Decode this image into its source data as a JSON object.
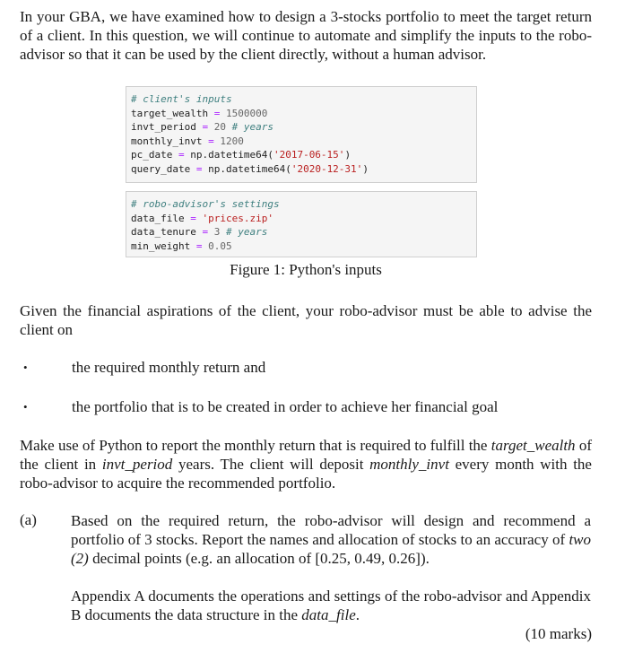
{
  "intro": {
    "text": "In your GBA, we have examined how to design a 3-stocks portfolio to meet the target return of a client. In this question, we will continue to automate and simplify the inputs to the robo-advisor so that it can be used by the client directly, without a human advisor."
  },
  "code_client": {
    "comment": "# client's inputs",
    "line1": {
      "name": "target_wealth",
      "op": "=",
      "value": "1500000"
    },
    "line2": {
      "name": "invt_period",
      "op": "=",
      "value": "20",
      "comment": "# years"
    },
    "line3": {
      "name": "monthly_invt",
      "op": "=",
      "value": "1200"
    },
    "line4": {
      "name": "pc_date",
      "op": "=",
      "call": "np.datetime64(",
      "value": "'2017-06-15'",
      "close": ")"
    },
    "line5": {
      "name": "query_date",
      "op": "=",
      "call": "np.datetime64(",
      "value": "'2020-12-31'",
      "close": ")"
    }
  },
  "code_robo": {
    "comment": "# robo-advisor's settings",
    "line1": {
      "name": "data_file",
      "op": "=",
      "value": "'prices.zip'"
    },
    "line2": {
      "name": "data_tenure",
      "op": "=",
      "value": "3",
      "comment": "# years"
    },
    "line3": {
      "name": "min_weight",
      "op": "=",
      "value": "0.05"
    }
  },
  "figure_caption": "Figure 1: Python's inputs",
  "given_para": "Given the financial aspirations of the client, your robo-advisor must be able to advise the client on",
  "bullets": [
    {
      "symbol": "•",
      "text": "the required monthly return and"
    },
    {
      "symbol": "•",
      "text": "the portfolio that is to be created in order to achieve her financial goal"
    }
  ],
  "make_use": {
    "part1": "Make use of Python to report the monthly return that is required to fulfill the ",
    "em1": "target_wealth",
    "part2": " of the client in ",
    "em2": "invt_period",
    "part3": " years. The client will deposit ",
    "em3": "monthly_invt",
    "part4": " every month with the robo-advisor to acquire the recommended portfolio."
  },
  "question_a": {
    "label": "(a)",
    "part1": "Based on the required return, the robo-advisor will design and recommend a portfolio of 3 stocks. Report the names and allocation of stocks to an accuracy of ",
    "em1": "two",
    "part2": " ",
    "em2": "(2)",
    "part3": " decimal points (e.g. an allocation of [0.25, 0.49, 0.26]).",
    "appendix_part1": "Appendix A documents the operations and settings of the robo-advisor and Appendix B documents the data structure in the ",
    "appendix_em": "data_file",
    "appendix_part2": ".",
    "marks": "(10 marks)"
  }
}
